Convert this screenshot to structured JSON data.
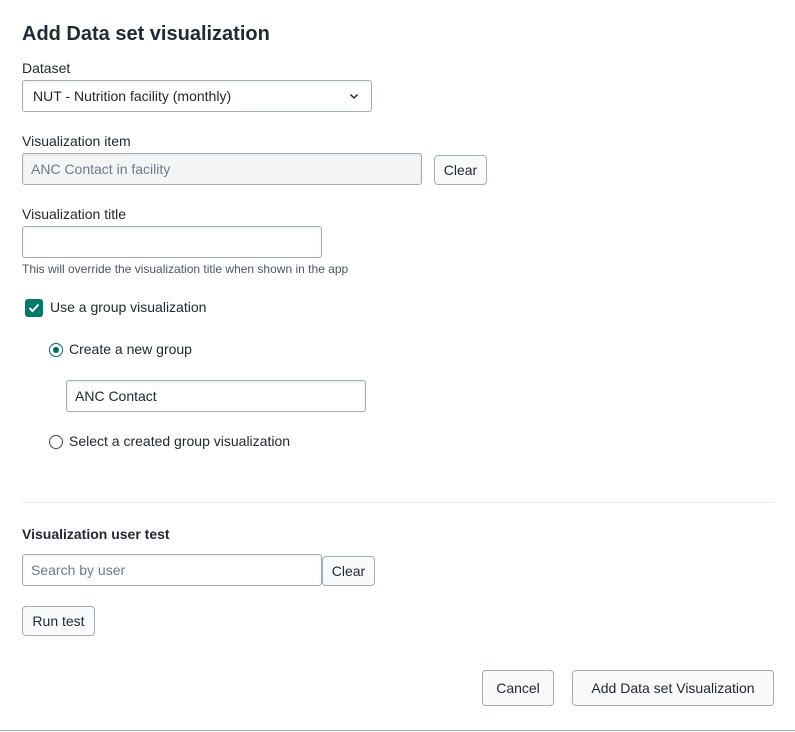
{
  "modal": {
    "title": "Add Data set visualization"
  },
  "dataset": {
    "label": "Dataset",
    "selected": "NUT - Nutrition facility (monthly)"
  },
  "visualization_item": {
    "label": "Visualization item",
    "value": "ANC Contact in facility",
    "clear_label": "Clear"
  },
  "visualization_title": {
    "label": "Visualization title",
    "value": "",
    "help": "This will override the visualization title when shown in the app"
  },
  "group": {
    "checkbox_label": "Use a group visualization",
    "checked": true,
    "create_new_label": "Create a new group",
    "new_group_name": "ANC Contact",
    "select_existing_label": "Select a created group visualization"
  },
  "user_test": {
    "label": "Visualization user test",
    "search_placeholder": "Search by user",
    "clear_label": "Clear",
    "run_label": "Run test"
  },
  "footer": {
    "cancel_label": "Cancel",
    "submit_label": "Add Data set Visualization"
  },
  "colors": {
    "accent": "#00796b",
    "border": "#a0adba",
    "text": "#212934"
  }
}
